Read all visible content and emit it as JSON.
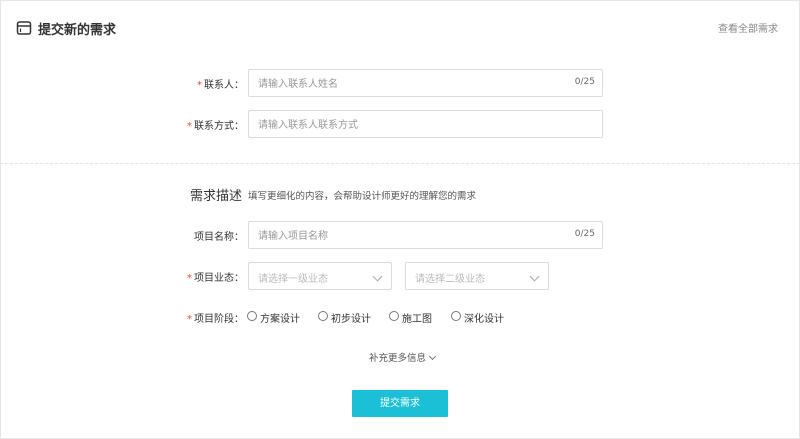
{
  "header": {
    "title": "提交新的需求",
    "view_all": "查看全部需求"
  },
  "contact": {
    "name_label": "联系人：",
    "name_placeholder": "请输入联系人姓名",
    "name_counter": "0/25",
    "method_label": "联系方式：",
    "method_placeholder": "请输入联系人联系方式"
  },
  "requirement": {
    "section_title": "需求描述",
    "section_desc": "填写更细化的内容，会帮助设计师更好的理解您的需求",
    "project_name_label": "项目名称：",
    "project_name_placeholder": "请输入项目名称",
    "project_name_counter": "0/25",
    "project_type_label": "项目业态：",
    "primary_type_placeholder": "请选择一级业态",
    "secondary_type_placeholder": "请选择二级业态",
    "project_stage_label": "项目阶段：",
    "stages": [
      "方案设计",
      "初步设计",
      "施工图",
      "深化设计"
    ]
  },
  "more_info": "补充更多信息",
  "submit_label": "提交需求",
  "required_mark": "*",
  "colors": {
    "accent": "#1cc0d6",
    "required": "#e8463f"
  }
}
